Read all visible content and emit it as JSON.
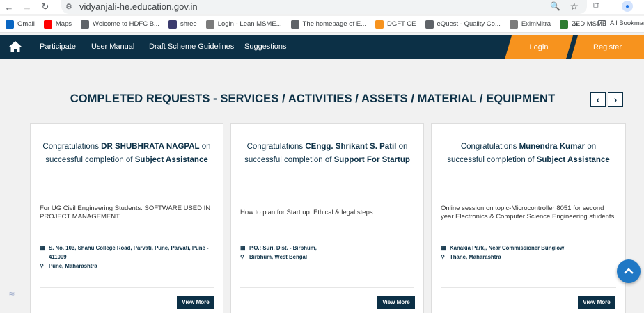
{
  "browser": {
    "url": "vidyanjali-he.education.gov.in",
    "bookmarks": [
      {
        "label": "Gmail",
        "icon": "gmail-icon",
        "color": "#0a66c2"
      },
      {
        "label": "Maps",
        "icon": "youtube-icon",
        "color": "#ff0000"
      },
      {
        "label": "Welcome to HDFC B...",
        "icon": "globe-icon",
        "color": "#5f6368"
      },
      {
        "label": "shree",
        "icon": "flag-icon",
        "color": "#3c3b6e"
      },
      {
        "label": "Login - Lean MSME...",
        "icon": "page-icon",
        "color": "#7b7b7b"
      },
      {
        "label": "The homepage of E...",
        "icon": "globe-icon",
        "color": "#5f6368"
      },
      {
        "label": "DGFT CE",
        "icon": "emblem-icon",
        "color": "#f7931e"
      },
      {
        "label": "eQuest - Quality Co...",
        "icon": "globe-icon",
        "color": "#5f6368"
      },
      {
        "label": "EximMitra",
        "icon": "page-icon",
        "color": "#7b7b7b"
      },
      {
        "label": "ZED MSME",
        "icon": "zed-icon",
        "color": "#2e7d32"
      }
    ],
    "more_label": "»",
    "all_bookmarks": "All Bookmar"
  },
  "nav": {
    "links": [
      "Participate",
      "User Manual",
      "Draft Scheme Guidelines",
      "Suggestions"
    ],
    "login": "Login",
    "register": "Register"
  },
  "page": {
    "heading": "COMPLETED REQUESTS - SERVICES / ACTIVITIES / ASSETS / MATERIAL / EQUIPMENT",
    "prev": "‹",
    "next": "›"
  },
  "cards": [
    {
      "congrats": "Congratulations",
      "name": "DR SHUBHRATA NAGPAL",
      "on": "on",
      "completion": "successful completion of",
      "service": "Subject Assistance",
      "description": "For UG Civil Engineering Students: SOFTWARE USED IN PROJECT MANAGEMENT",
      "address": "S. No. 103, Shahu College Road, Parvati, Pune, Parvati, Pune - 411009",
      "location": "Pune, Maharashtra",
      "button": "View More"
    },
    {
      "congrats": "Congratulations",
      "name": "CEngg. Shrikant S. Patil",
      "on": "on",
      "completion": "successful completion of",
      "service": "Support For Startup",
      "description": "How to plan for Start up: Ethical & legal steps",
      "address": "P.O.: Suri, Dist. - Birbhum,",
      "location": "Birbhum, West Bengal",
      "button": "View More"
    },
    {
      "congrats": "Congratulations",
      "name": "Munendra Kumar",
      "on": "on",
      "completion": "successful completion of",
      "service": "Subject Assistance",
      "description": "Online session on topic-Microcontroller 8051 for second year Electronics & Computer Science Engineering students",
      "address": "Kanakia Park,, Near Commissioner Bunglow",
      "location": "Thane, Maharashtra",
      "button": "View More"
    }
  ],
  "colors": {
    "primary": "#0c3046",
    "accent": "#f7931e",
    "fab": "#1f78c5"
  }
}
